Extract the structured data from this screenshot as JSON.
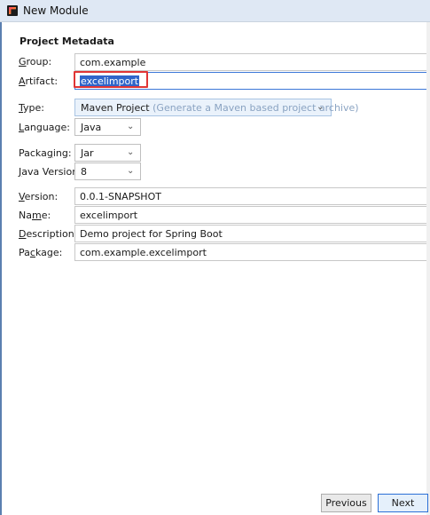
{
  "window": {
    "title": "New Module"
  },
  "section": {
    "title": "Project Metadata"
  },
  "fields": {
    "group": {
      "label_u": "G",
      "label_rest": "roup:",
      "value": "com.example"
    },
    "artifact": {
      "label_u": "A",
      "label_rest": "rtifact:",
      "value": "excelimport"
    },
    "version": {
      "label_u": "V",
      "label_rest": "ersion:",
      "value": "0.0.1-SNAPSHOT"
    },
    "name": {
      "label_pre": "Na",
      "label_u": "m",
      "label_rest": "e:",
      "value": "excelimport"
    },
    "description": {
      "label_u": "D",
      "label_rest": "escription:",
      "value": "Demo project for Spring Boot"
    },
    "package": {
      "label_pre": "Pa",
      "label_u": "c",
      "label_rest": "kage:",
      "value": "com.example.excelimport"
    }
  },
  "selects": {
    "type": {
      "label_u": "T",
      "label_rest": "ype:",
      "value": "Maven Project",
      "hint": "(Generate a Maven based project archive)"
    },
    "language": {
      "label_u": "L",
      "label_rest": "anguage:",
      "value": "Java"
    },
    "packaging": {
      "label_pre": "Packa",
      "label_u": "g",
      "label_rest": "ing:",
      "value": "Jar"
    },
    "java_version": {
      "label_u": "J",
      "label_rest": "ava Version:",
      "value": "8"
    }
  },
  "buttons": {
    "previous": "Previous",
    "next": "Next"
  },
  "colors": {
    "selection": "#2f65ca",
    "highlight_box": "#e03535",
    "focus_border": "#3b77d8"
  }
}
